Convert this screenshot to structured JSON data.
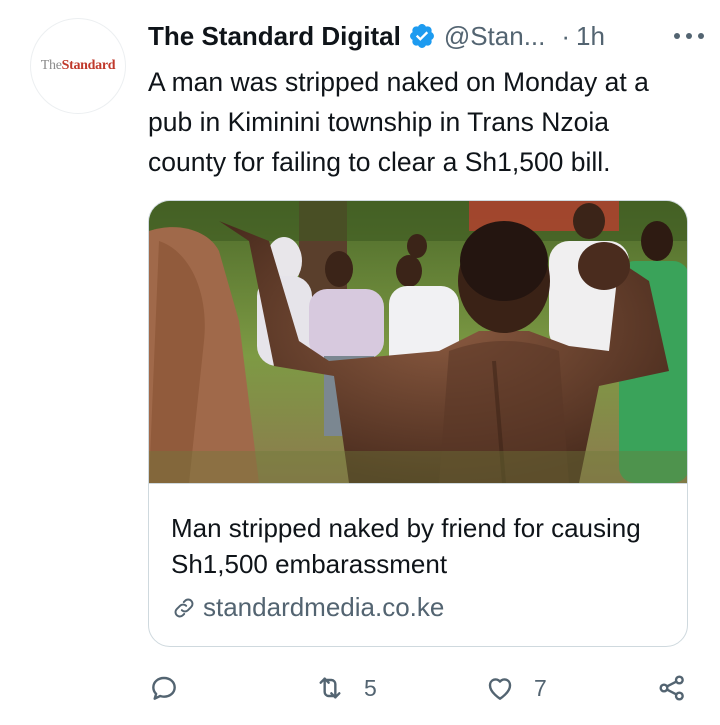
{
  "account": {
    "avatar_text_the": "The",
    "avatar_text_standard": "Standard",
    "display_name": "The Standard Digital",
    "handle": "@Stan...",
    "separator": "·",
    "time": "1h"
  },
  "tweet": {
    "text": "A man was stripped naked on Monday at a pub in Kiminini township in Trans Nzoia county for failing to clear a Sh1,500 bill."
  },
  "card": {
    "title": "Man stripped naked by friend for causing Sh1,500 embarassment",
    "domain": "standardmedia.co.ke"
  },
  "actions": {
    "reply_count": "",
    "retweet_count": "5",
    "like_count": "7"
  },
  "colors": {
    "text_primary": "#0f1419",
    "text_secondary": "#536471",
    "verified_blue": "#1d9bf0",
    "border": "#cfd9de",
    "brand_red": "#c0392b"
  },
  "icons": {
    "verified": "verified-badge-icon",
    "more": "more-horizontal-icon",
    "link": "link-icon",
    "reply": "reply-icon",
    "retweet": "retweet-icon",
    "like": "heart-icon",
    "share": "share-icon"
  }
}
